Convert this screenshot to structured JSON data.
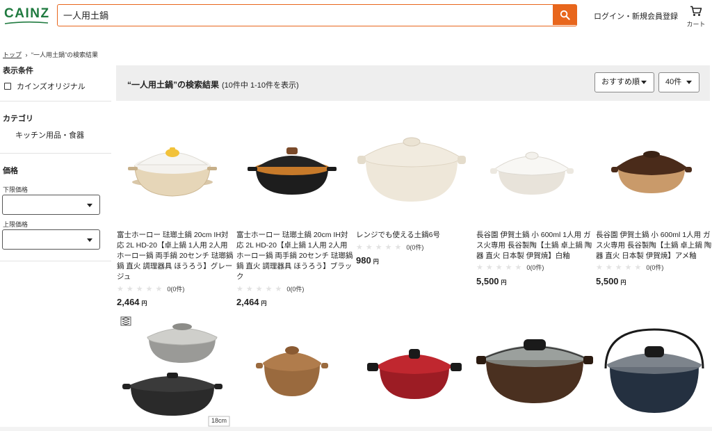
{
  "header": {
    "logo": "CAINZ",
    "search": {
      "value": "一人用土鍋",
      "placeholder": ""
    },
    "login_label": "ログイン・新規会員登録",
    "cart_label": "カート",
    "icons": {
      "search": "search-icon",
      "cart": "cart-icon"
    },
    "colors": {
      "accent": "#e8661c",
      "brand": "#1f7a3f"
    }
  },
  "breadcrumb": {
    "home": "トップ",
    "separator": "›",
    "current": "“一人用土鍋”の検索結果"
  },
  "sidebar": {
    "display_conditions": {
      "title": "表示条件",
      "cainz_original": "カインズオリジナル"
    },
    "category": {
      "title": "カテゴリ",
      "item": "キッチン用品・食器"
    },
    "price": {
      "title": "価格",
      "min_label": "下限価格",
      "max_label": "上限価格",
      "min_value": "",
      "max_value": ""
    }
  },
  "results": {
    "title": "“一人用土鍋”の検索結果",
    "count": "(10件中 1-10件を表示)",
    "sort": "おすすめ順",
    "per_page": "40件"
  },
  "products": [
    {
      "name": "富士ホーロー 琺瑯土鍋 20cm IH対応 2L HD-20【卓上鍋 1人用 2人用 ホーロー鍋 両手鍋 20センチ 琺瑯鍋 鍋 直火 調理器具 ほうろう】グレージュ",
      "reviews": "0(0件)",
      "price": "2,464",
      "yen": "円",
      "rating": 0
    },
    {
      "name": "富士ホーロー 琺瑯土鍋 20cm IH対応 2L HD-20【卓上鍋 1人用 2人用 ホーロー鍋 両手鍋 20センチ 琺瑯鍋 鍋 直火 調理器具 ほうろう】ブラック",
      "reviews": "0(0件)",
      "price": "2,464",
      "yen": "円",
      "rating": 0
    },
    {
      "name": "レンジでも使える土鍋6号",
      "reviews": "0(0件)",
      "price": "980",
      "yen": "円",
      "rating": 0
    },
    {
      "name": "長谷園 伊賀土鍋 小 600ml 1人用 ガス火専用 長谷製陶【土鍋 卓上鍋 陶器 直火 日本製 伊賀焼】白釉",
      "reviews": "0(0件)",
      "price": "5,500",
      "yen": "円",
      "rating": 0
    },
    {
      "name": "長谷園 伊賀土鍋 小 600ml 1人用 ガス火専用 長谷製陶【土鍋 卓上鍋 陶器 直火 日本製 伊賀焼】アメ釉",
      "reviews": "0(0件)",
      "price": "5,500",
      "yen": "円",
      "rating": 0
    }
  ],
  "row2": {
    "size_badge": "18cm"
  }
}
